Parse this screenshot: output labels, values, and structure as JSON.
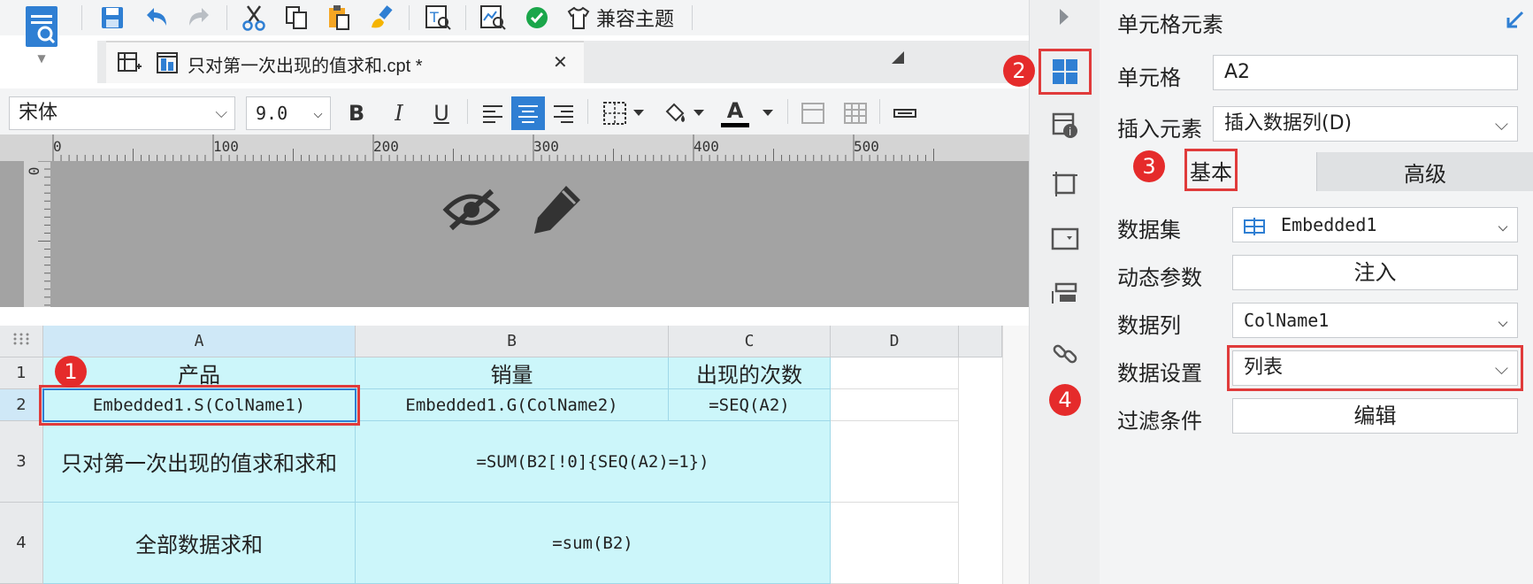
{
  "toolbar": {
    "theme_label": "兼容主题",
    "icons": [
      "template-icon",
      "save-icon",
      "undo-icon",
      "redo-icon",
      "cut-icon",
      "copy-icon",
      "paste-icon",
      "format-brush-icon",
      "text-preview-icon",
      "data-preview-icon",
      "check-icon",
      "theme-shirt-icon"
    ]
  },
  "tab": {
    "title": "只对第一次出现的值求和.cpt *",
    "close": "✕"
  },
  "format": {
    "font_name": "宋体",
    "font_size": "9.0",
    "bold": "B",
    "italic": "I",
    "underline": "U",
    "font_color": "A"
  },
  "ruler": {
    "h_labels": [
      "0",
      "100",
      "200",
      "300",
      "400",
      "500"
    ],
    "v_label": "0"
  },
  "grid": {
    "columns": [
      "A",
      "B",
      "C",
      "D"
    ],
    "rows": [
      "1",
      "2",
      "3",
      "4"
    ],
    "cells": {
      "A1": "产品",
      "B1": "销量",
      "C1": "出现的次数",
      "A2": "Embedded1.S(ColName1)",
      "B2": "Embedded1.G(ColName2)",
      "C2": "=SEQ(A2)",
      "A3": "只对第一次出现的值求和求和",
      "B3": "=SUM(B2[!0]{SEQ(A2)=1})",
      "A4": "全部数据求和",
      "B4": "=sum(B2)"
    },
    "cell_color": "#ccf6fa"
  },
  "markers": [
    "1",
    "2",
    "3",
    "4"
  ],
  "panel": {
    "title": "单元格元素",
    "cell_label": "单元格",
    "cell_value": "A2",
    "insert_label": "插入元素",
    "insert_value": "插入数据列(D)",
    "tab_basic": "基本",
    "tab_advanced": "高级",
    "dataset_label": "数据集",
    "dataset_value": "Embedded1",
    "dyn_param_label": "动态参数",
    "dyn_param_btn": "注入",
    "column_label": "数据列",
    "column_value": "ColName1",
    "data_setting_label": "数据设置",
    "data_setting_value": "列表",
    "filter_label": "过滤条件",
    "filter_btn": "编辑"
  },
  "accent": "#e03b3b",
  "selection_blue": "#2f7fd3"
}
